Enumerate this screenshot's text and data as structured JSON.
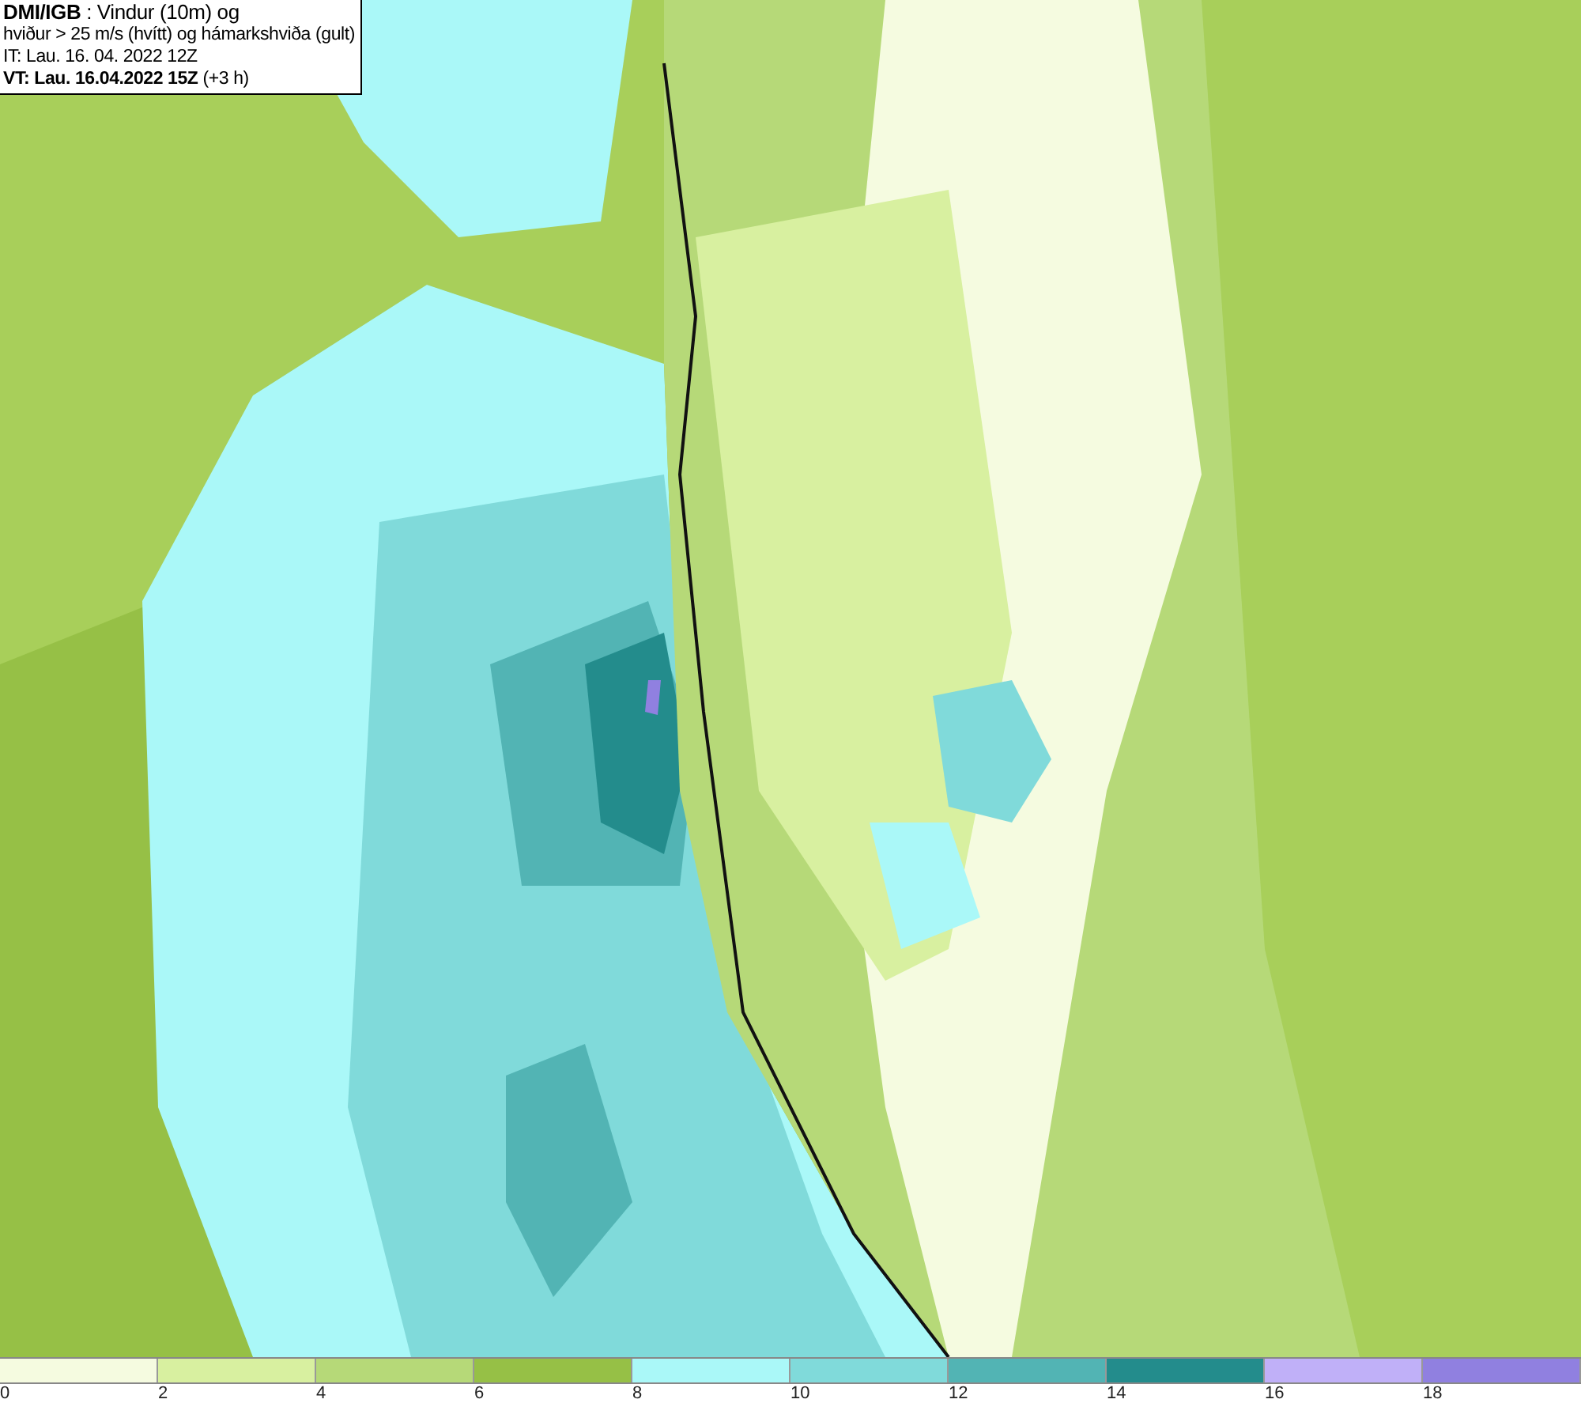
{
  "header": {
    "lines": [
      "**DMI/IGB** : Vindur (10m) og",
      "hviður > 25 m/s (hvítt) og hámarkshviða (gult)",
      "IT: Lau. 16. 04. 2022 12Z",
      "**VT: Lau. 16.04.2022 15Z** (+3 h)"
    ]
  },
  "legend": [
    {
      "label": "0",
      "color": "#f5fbe0"
    },
    {
      "label": "2",
      "color": "#d8f0a0"
    },
    {
      "label": "4",
      "color": "#b6d978"
    },
    {
      "label": "6",
      "color": "#96c046"
    },
    {
      "label": "8",
      "color": "#aaf8f8"
    },
    {
      "label": "10",
      "color": "#80dada"
    },
    {
      "label": "12",
      "color": "#52b4b4"
    },
    {
      "label": "14",
      "color": "#238c8c"
    },
    {
      "label": "16",
      "color": "#c0b0f8"
    },
    {
      "label": "18",
      "color": "#9080e0"
    }
  ]
}
